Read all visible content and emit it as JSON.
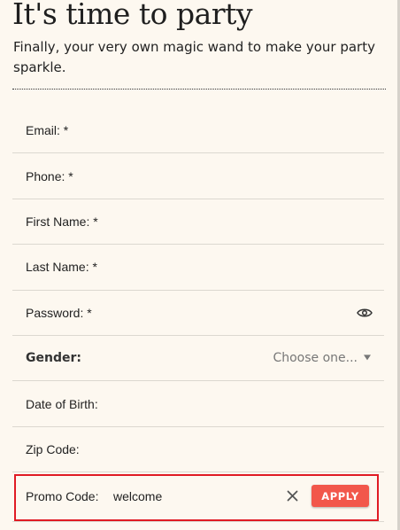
{
  "header": {
    "title": "It's time to party",
    "subtitle": "Finally, your very own magic wand to make your party sparkle."
  },
  "form": {
    "email_label": "Email: *",
    "phone_label": "Phone: *",
    "first_name_label": "First Name: *",
    "last_name_label": "Last Name: *",
    "password_label": "Password: *",
    "gender_label": "Gender:",
    "gender_value": "Choose one...",
    "dob_label": "Date of Birth:",
    "zip_label": "Zip Code:",
    "promo_label": "Promo Code:",
    "promo_value": "welcome",
    "apply_label": "APPLY"
  },
  "colors": {
    "background": "#fdf8f0",
    "accent": "#f2574b",
    "highlight": "#e01b24"
  },
  "icons": {
    "password_toggle": "eye-icon",
    "clear_promo": "close-icon",
    "gender_dropdown": "caret-down-icon"
  }
}
